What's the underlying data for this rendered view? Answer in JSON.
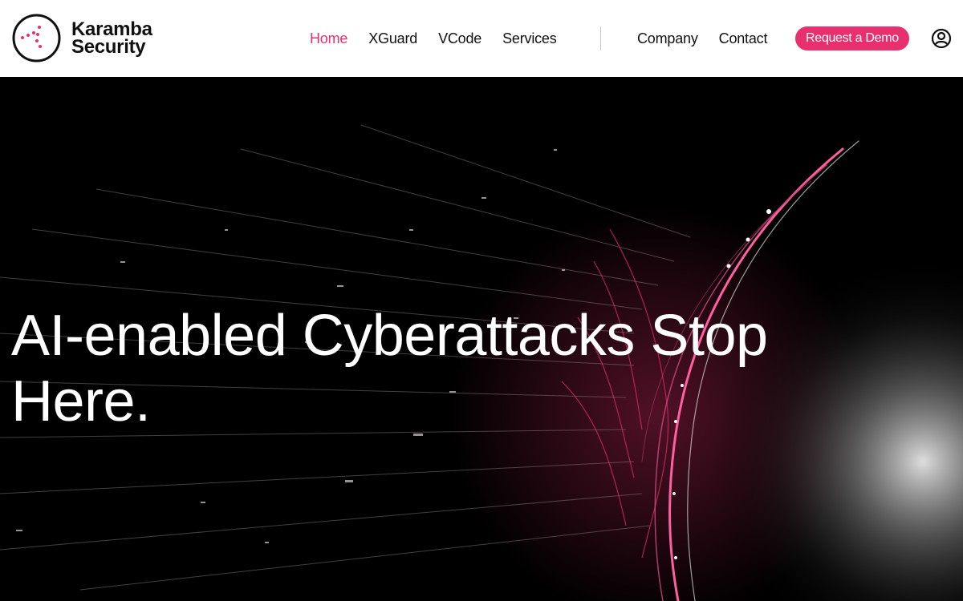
{
  "brand": {
    "name_line1": "Karamba",
    "name_line2": "Security",
    "accent_color": "#e8306e"
  },
  "nav": {
    "primary": [
      {
        "label": "Home",
        "active": true
      },
      {
        "label": "XGuard",
        "active": false
      },
      {
        "label": "VCode",
        "active": false
      },
      {
        "label": "Services",
        "active": false
      }
    ],
    "secondary": [
      {
        "label": "Company"
      },
      {
        "label": "Contact"
      }
    ],
    "cta_label": "Request a Demo",
    "account_icon": "user-circle-icon"
  },
  "hero": {
    "title": "AI-enabled Cyberattacks Stop Here."
  }
}
